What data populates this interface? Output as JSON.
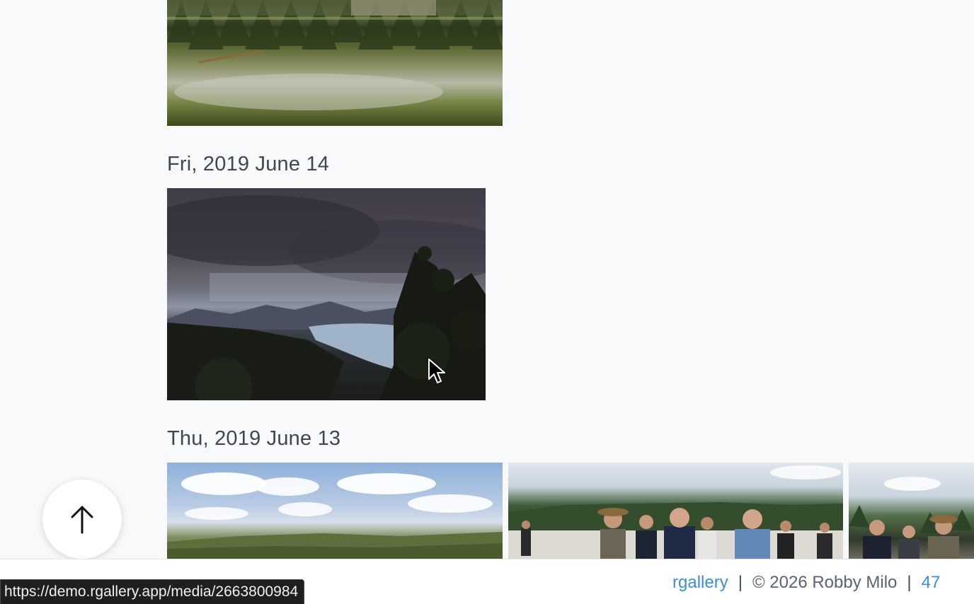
{
  "gallery": {
    "groups": [
      {
        "date": "Fri, 2019 June 14"
      },
      {
        "date": "Thu, 2019 June 13"
      }
    ]
  },
  "scroll_top": {
    "icon": "arrow-up-icon"
  },
  "footer": {
    "app_link": "rgallery",
    "separator": "|",
    "copyright": "© 2026 Robby Milo",
    "extra": "47"
  },
  "status_bar": {
    "url": "https://demo.rgallery.app/media/2663800984"
  },
  "colors": {
    "background": "#f8f9fb",
    "heading": "#3f4654",
    "link": "#3b8fd8",
    "footer_text": "#5b6270"
  }
}
